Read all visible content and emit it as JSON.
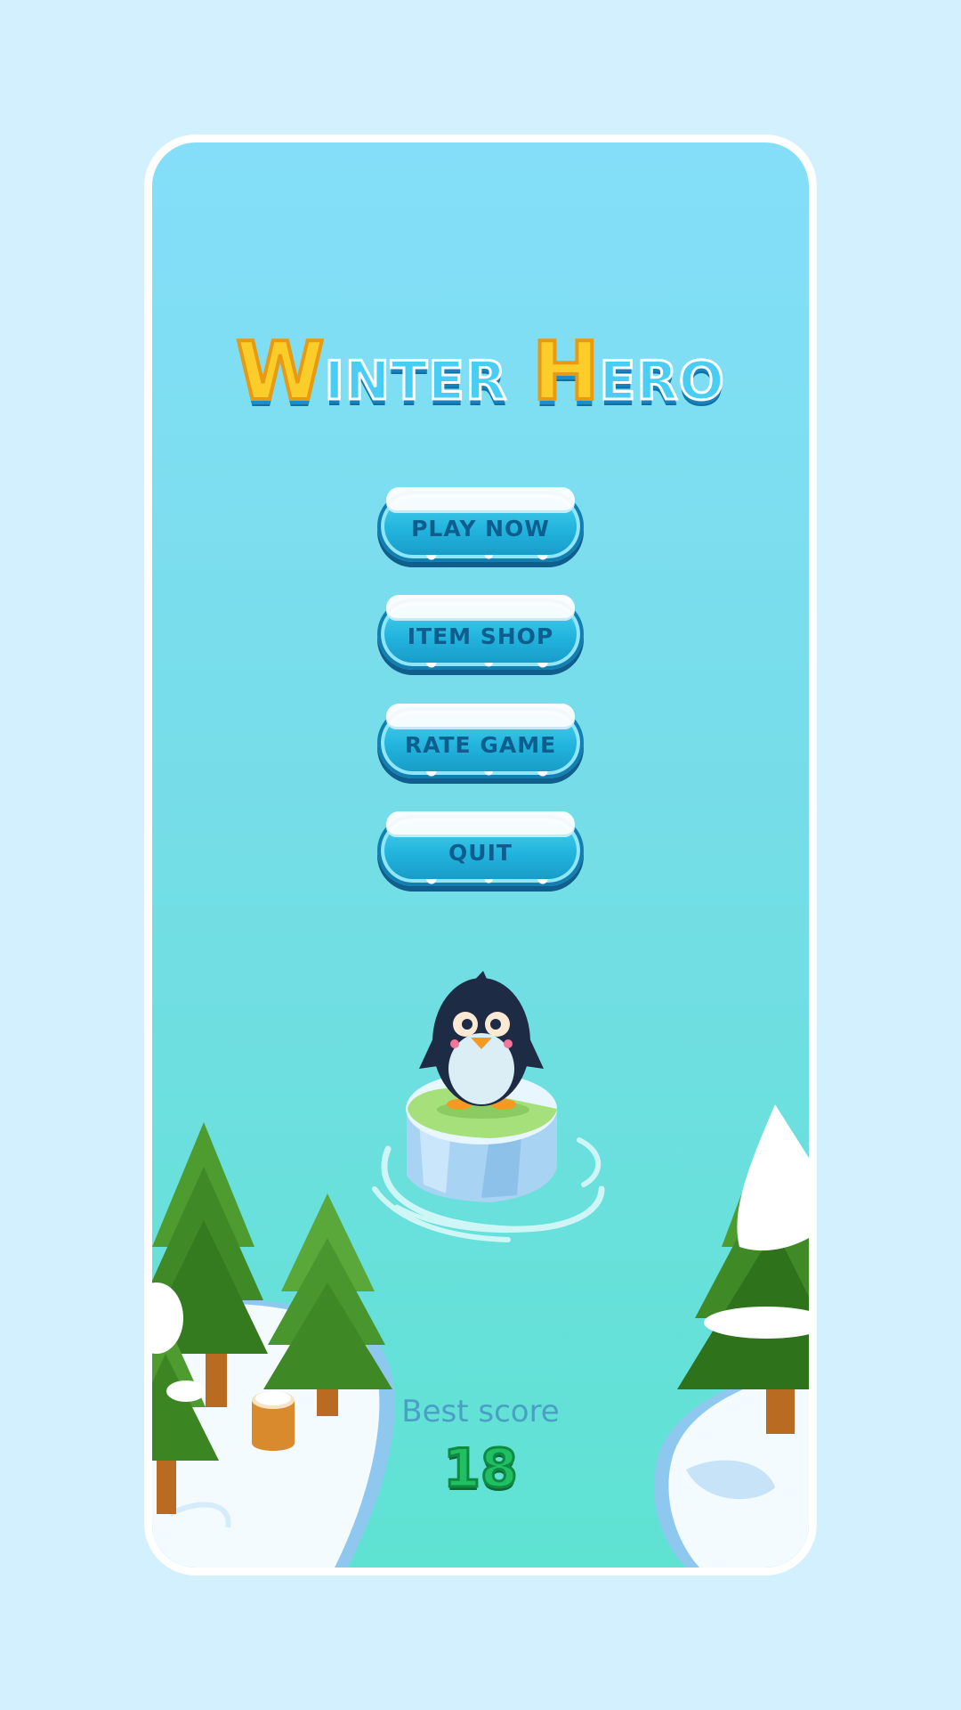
{
  "title": {
    "word1_cap": "W",
    "word1_rest": "INTER",
    "word2_cap": "H",
    "word2_rest": "ERO"
  },
  "menu": {
    "play_label": "PLAY NOW",
    "shop_label": "ITEM SHOP",
    "rate_label": "RATE GAME",
    "quit_label": "QUIT"
  },
  "score": {
    "label": "Best score",
    "value": "18"
  },
  "colors": {
    "background": "#d3f0fe",
    "sky_top": "#84def9",
    "water_bottom": "#5ee2d2",
    "button": "#22b4dd",
    "title_yellow": "#fbcd2b",
    "score_green": "#1fbf62"
  },
  "icons": {
    "character": "penguin",
    "platform": "ice-floe",
    "scenery": "snowy-pine-trees"
  }
}
